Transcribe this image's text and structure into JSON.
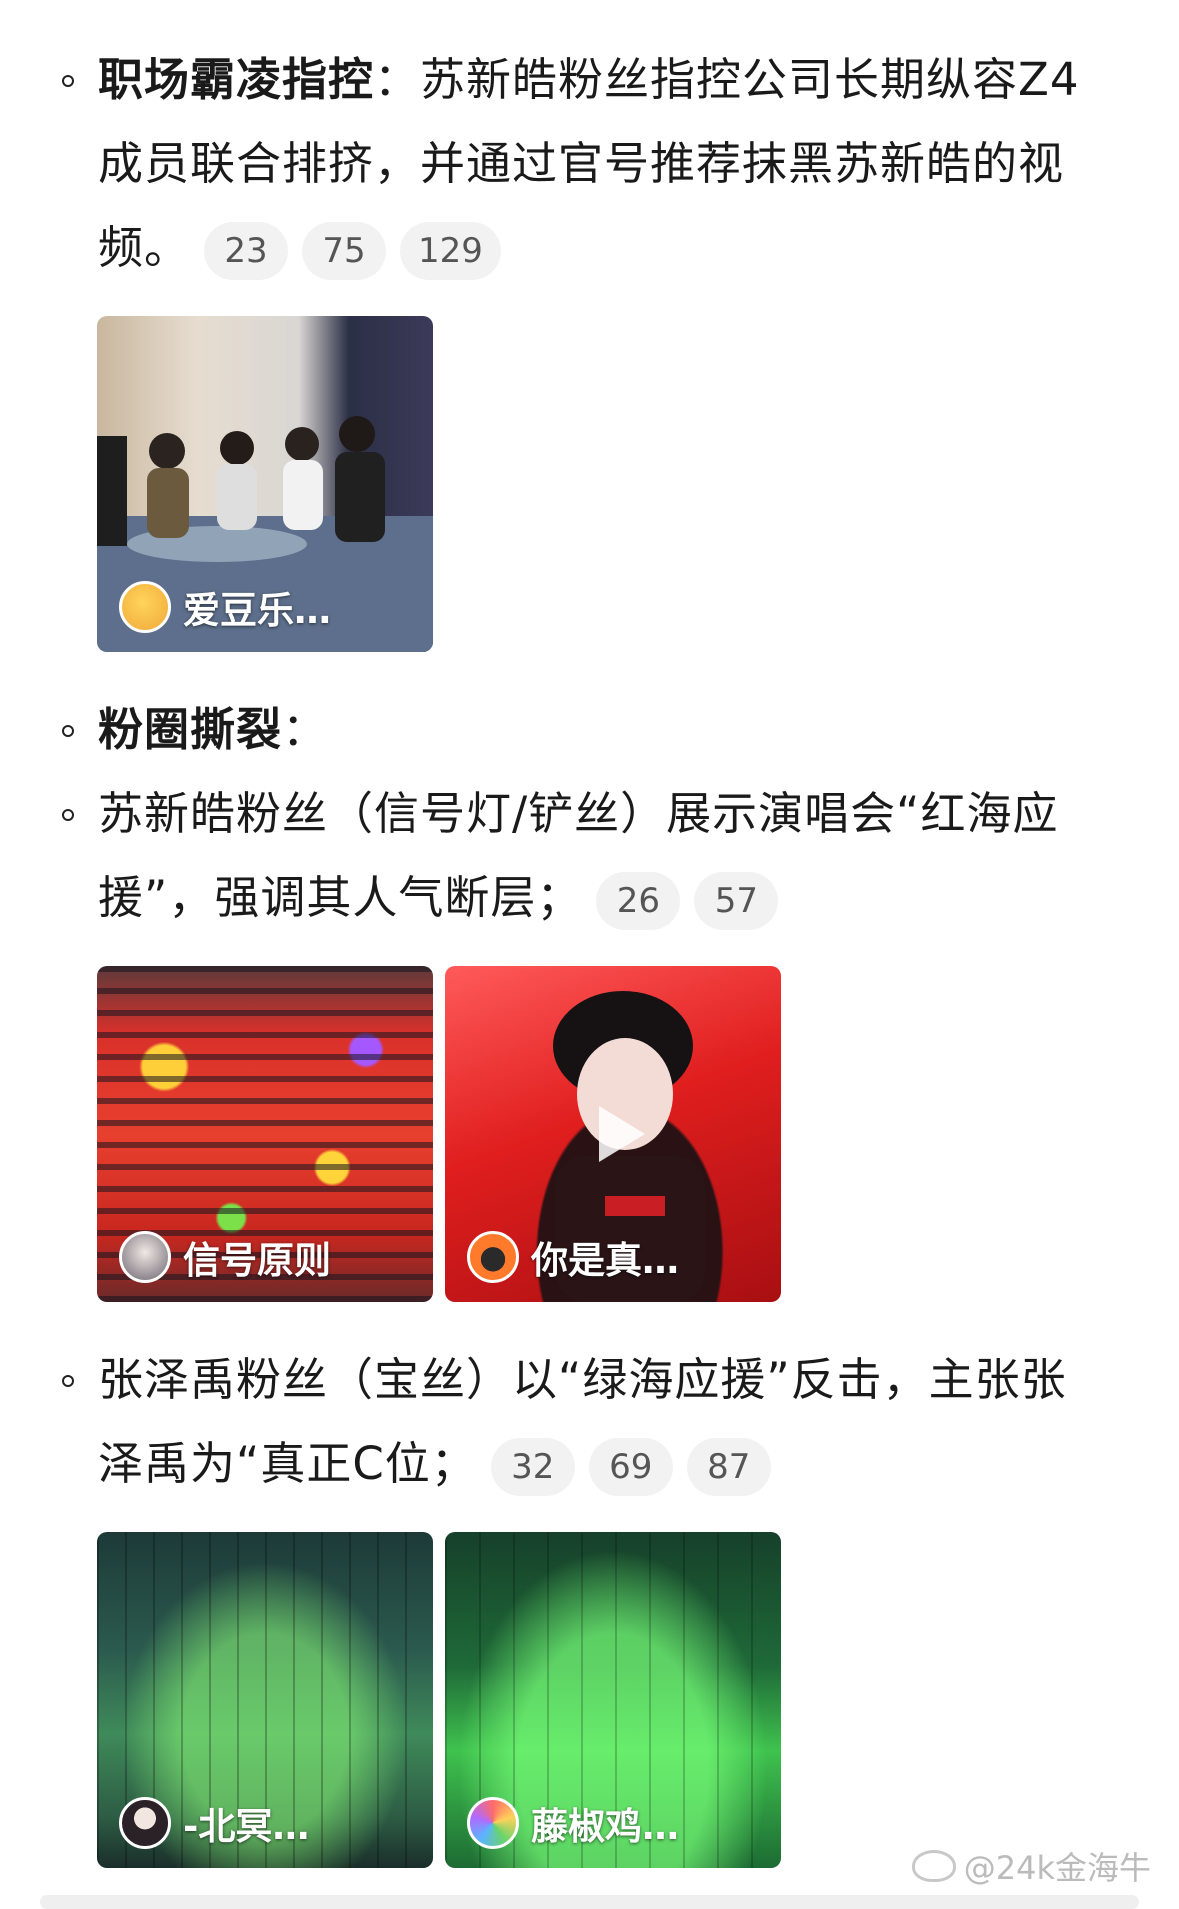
{
  "items": [
    {
      "bold": "职场霸凌指控",
      "text_lines": [
        "：苏新皓粉丝指控公司长期纵容Z4",
        "成员联合排挤，并通过官号推荐抹黑苏新皓的视",
        "频。"
      ],
      "refs": [
        "23",
        "75",
        "129"
      ],
      "thumbs": [
        {
          "label": "爱豆乐…",
          "avatar": "avatar-icon",
          "theme": "dorm-room"
        }
      ]
    },
    {
      "bold": "粉圈撕裂",
      "text_lines": [
        "："
      ],
      "refs": [],
      "thumbs": []
    },
    {
      "bold": "",
      "text_lines": [
        "苏新皓粉丝（信号灯/铲丝）展示演唱会“红海应",
        "援”，强调其人气断层；"
      ],
      "refs": [
        "26",
        "57"
      ],
      "thumbs": [
        {
          "label": "信号原则",
          "avatar": "avatar-icon",
          "theme": "red-stadium"
        },
        {
          "label": "你是真…",
          "avatar": "avatar-icon",
          "theme": "red-performer",
          "video": true
        }
      ]
    },
    {
      "bold": "",
      "text_lines": [
        "张泽禹粉丝（宝丝）以“绿海应援”反击，主张张",
        "泽禹为“真正C位；"
      ],
      "refs": [
        "32",
        "69",
        "87"
      ],
      "thumbs": [
        {
          "label": "-北冥…",
          "avatar": "avatar-icon",
          "theme": "green-stadium"
        },
        {
          "label": "藤椒鸡…",
          "avatar": "avatar-icon",
          "theme": "green-stadium-2"
        }
      ]
    }
  ],
  "footer": {
    "watermark": "@24k金海牛",
    "icon": "weibo-icon"
  }
}
